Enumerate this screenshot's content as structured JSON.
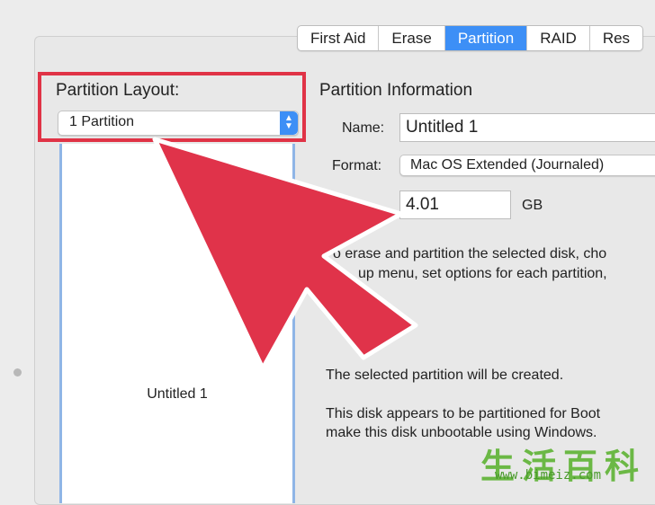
{
  "tabs": [
    {
      "label": "First Aid",
      "active": false
    },
    {
      "label": "Erase",
      "active": false
    },
    {
      "label": "Partition",
      "active": true
    },
    {
      "label": "RAID",
      "active": false
    },
    {
      "label": "Res",
      "active": false
    }
  ],
  "layout": {
    "label": "Partition Layout:",
    "selected": "1 Partition",
    "stepper_up": "▲",
    "stepper_down": "▼"
  },
  "map": {
    "partition_label": "Untitled 1"
  },
  "info": {
    "title": "Partition Information",
    "name_label": "Name:",
    "name_value": "Untitled 1",
    "format_label": "Format:",
    "format_value": "Mac OS Extended (Journaled)",
    "size_value": "4.01",
    "size_unit": "GB"
  },
  "description": {
    "line1": "o erase and partition the selected disk, cho",
    "line2": "up menu, set options for each partition,",
    "line3": "The selected partition will be created.",
    "line4": "This disk appears to be partitioned for Boot",
    "line5": "make this disk unbootable using Windows."
  },
  "watermark": {
    "text_cn": "生活百科",
    "url": "www.bimeiz.com"
  },
  "colors": {
    "accent_blue": "#3d8ff6",
    "highlight_red": "#e03346",
    "arrow_red": "#e0334a",
    "watermark_green": "#6bb845"
  }
}
